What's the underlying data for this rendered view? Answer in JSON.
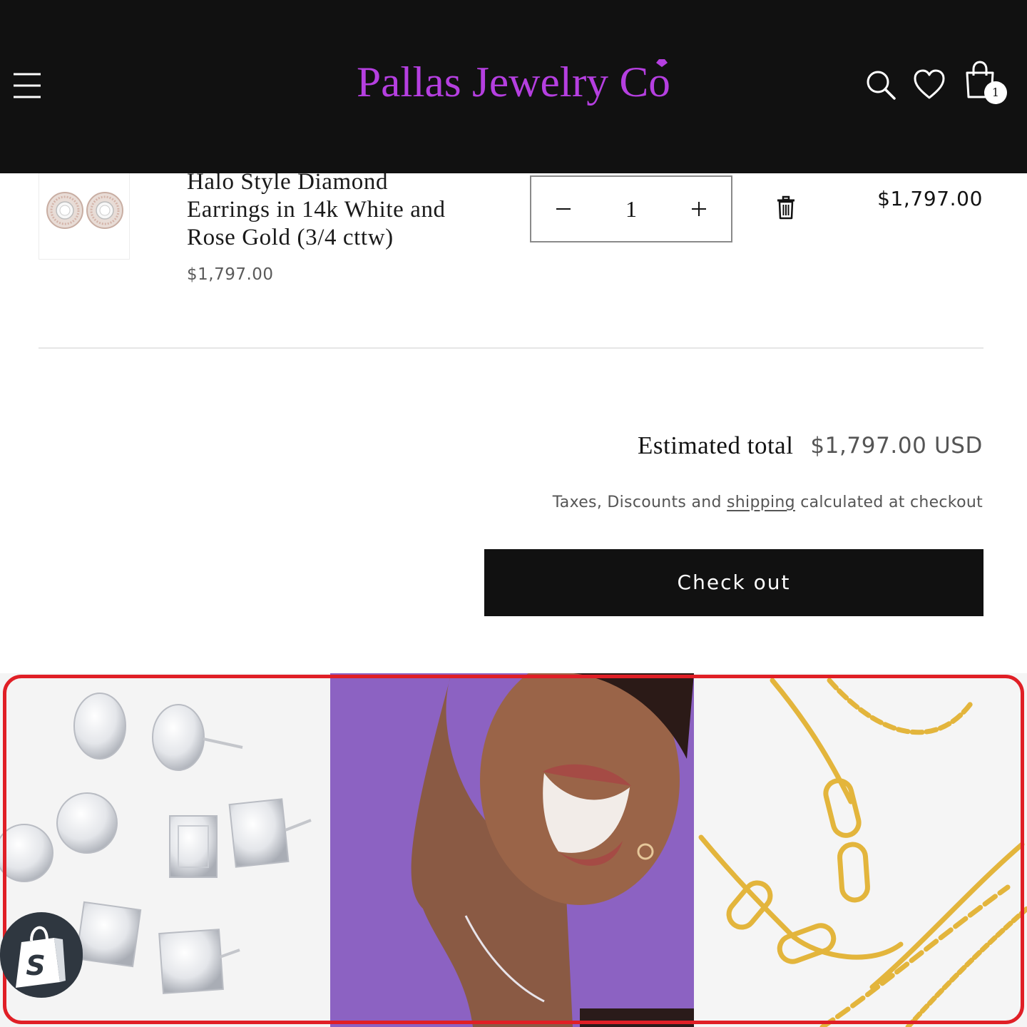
{
  "header": {
    "brand": "Pallas Jewelry Co",
    "cart_count": "1"
  },
  "cart": {
    "item": {
      "title_lines": [
        "Halo Style Diamond",
        "Earrings in 14k White and",
        "Rose Gold (3/4 cttw)"
      ],
      "unit_price": "$1,797.00",
      "quantity": "1",
      "line_total": "$1,797.00"
    }
  },
  "totals": {
    "estimated_label": "Estimated total",
    "estimated_value": "$1,797.00 USD",
    "tax_note_before": "Taxes, Discounts and ",
    "tax_note_link": "shipping",
    "tax_note_after": " calculated at checkout",
    "checkout_label": "Check out"
  },
  "icons": {
    "menu": "hamburger-icon",
    "search": "search-icon",
    "wishlist": "heart-icon",
    "cart": "shopping-bag-icon",
    "delete": "trash-icon",
    "decrease": "minus-icon",
    "increase": "plus-icon",
    "shopify": "shopify-bag-icon"
  },
  "colors": {
    "header_bg": "#111111",
    "brand_purple": "#b53fe0",
    "checkout_bg": "#111111",
    "promo_purple": "#8c62c2",
    "highlight_red": "#e01f26",
    "gold": "#e3b53c"
  }
}
